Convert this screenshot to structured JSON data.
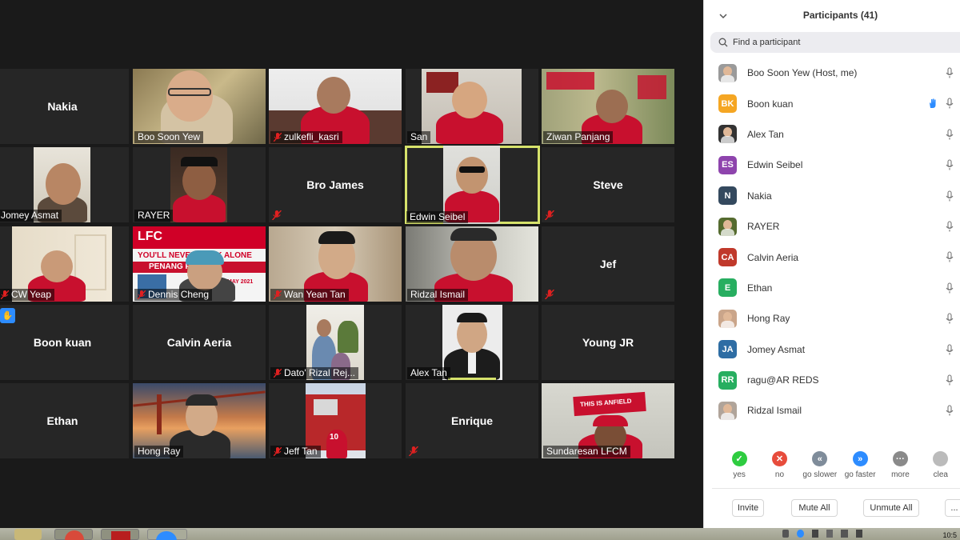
{
  "gallery": {
    "tiles": [
      {
        "name": "Nakia"
      },
      {
        "name": "Boo Soon Yew"
      },
      {
        "name": "zulkefli_kasri"
      },
      {
        "name": "San"
      },
      {
        "name": "Ziwan Panjang"
      },
      {
        "name": "Jomey Asmat"
      },
      {
        "name": "RAYER"
      },
      {
        "name": "Bro James"
      },
      {
        "name": "Edwin Seibel"
      },
      {
        "name": "Steve"
      },
      {
        "name": "CW Yeap"
      },
      {
        "name": "Dennis Cheng",
        "banner_line1": "LFC",
        "banner_line2": "YOU'LL NEVER WALK ALONE",
        "banner_line3": "PENANG RE",
        "banner_line4": "MAY 2021"
      },
      {
        "name": "Wan Yean Tan"
      },
      {
        "name": "Ridzal Ismail"
      },
      {
        "name": "Jef"
      },
      {
        "name": "Boon kuan"
      },
      {
        "name": "Calvin Aeria"
      },
      {
        "name": "Dato' Rizal Rej..."
      },
      {
        "name": "Alex Tan"
      },
      {
        "name": "Young JR"
      },
      {
        "name": "Ethan"
      },
      {
        "name": "Hong Ray"
      },
      {
        "name": "Jeff Tan",
        "shirt_number": "10"
      },
      {
        "name": "Enrique"
      },
      {
        "name": "Sundaresan LFCM",
        "banner_text": "THIS IS ANFIELD"
      }
    ]
  },
  "panel": {
    "title": "Participants (41)",
    "search_placeholder": "Find a participant",
    "participants": [
      {
        "name": "Boo Soon Yew (Host, me)",
        "initials": "",
        "color": "#9a9a9a"
      },
      {
        "name": "Boon kuan",
        "initials": "BK",
        "color": "#f5a623"
      },
      {
        "name": "Alex Tan",
        "initials": "",
        "color": "#333333"
      },
      {
        "name": "Edwin Seibel",
        "initials": "ES",
        "color": "#8e44ad"
      },
      {
        "name": "Nakia",
        "initials": "N",
        "color": "#34495e"
      },
      {
        "name": "RAYER",
        "initials": "",
        "color": "#556b2f"
      },
      {
        "name": "Calvin Aeria",
        "initials": "CA",
        "color": "#c0392b"
      },
      {
        "name": "Ethan",
        "initials": "E",
        "color": "#27ae60"
      },
      {
        "name": "Hong Ray",
        "initials": "",
        "color": "#caa58a"
      },
      {
        "name": "Jomey Asmat",
        "initials": "JA",
        "color": "#2e6da4"
      },
      {
        "name": "ragu@AR REDS",
        "initials": "RR",
        "color": "#27ae60"
      },
      {
        "name": "Ridzal Ismail",
        "initials": "",
        "color": "#b0a49a"
      }
    ],
    "reactions": [
      {
        "label": "yes",
        "color": "#2ecc40",
        "glyph": "✓"
      },
      {
        "label": "no",
        "color": "#e74c3c",
        "glyph": "✕"
      },
      {
        "label": "go slower",
        "color": "#7f8c9a",
        "glyph": "«"
      },
      {
        "label": "go faster",
        "color": "#2d8cff",
        "glyph": "»"
      },
      {
        "label": "more",
        "color": "#8a8a8a",
        "glyph": "···"
      },
      {
        "label": "clea",
        "color": "#bbbbbb",
        "glyph": ""
      }
    ],
    "actions": {
      "invite": "Invite",
      "mute_all": "Mute All",
      "unmute_all": "Unmute All",
      "more": "..."
    }
  },
  "taskbar": {
    "clock": "10:5"
  },
  "colors": {
    "gallery_bg": "#1a1a1a",
    "tile_bg": "#262626",
    "active_speaker": "#d6e26b",
    "raise_hand": "#2d8cff",
    "lfc_red": "#d00027"
  }
}
